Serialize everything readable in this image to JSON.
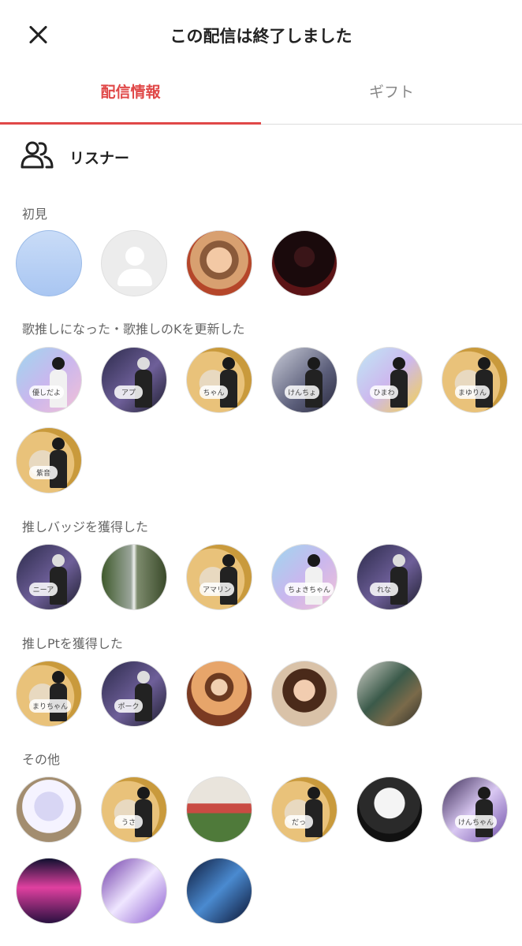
{
  "header": {
    "title": "この配信は終了しました"
  },
  "tabs": [
    {
      "label": "配信情報"
    },
    {
      "label": "ギフト"
    }
  ],
  "listeners": {
    "title": "リスナー"
  },
  "groups": [
    {
      "label": "初見"
    },
    {
      "label": "歌推しになった・歌推しのKを更新した"
    },
    {
      "label": "推しバッジを獲得した"
    },
    {
      "label": "推しPtを獲得した"
    },
    {
      "label": "その他"
    }
  ],
  "avatar_tags": {
    "g2": [
      "優しだよ",
      "アプ",
      "ちゃん",
      "けんちょ",
      "ひまわ",
      "まゆりん",
      "紫音"
    ],
    "g3": [
      "ニーア",
      "",
      "アマリン",
      "ちょきちゃん",
      "れな"
    ],
    "g4": [
      "まりちゃん",
      "ポーク",
      "",
      "",
      ""
    ],
    "g5": [
      "",
      "うさ",
      "",
      "だっ",
      "",
      "けんちゃん",
      "",
      "",
      ""
    ]
  },
  "colors": {
    "accent": "#e04848"
  }
}
